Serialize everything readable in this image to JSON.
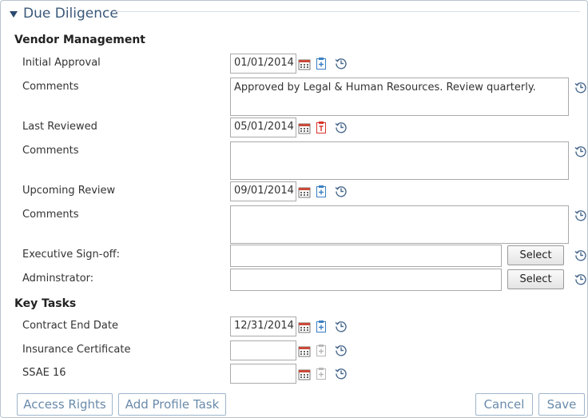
{
  "panel": {
    "title": "Due Diligence"
  },
  "vendor_management": {
    "heading": "Vendor Management",
    "initial_approval": {
      "label": "Initial Approval",
      "value": "01/01/2014"
    },
    "comments_1": {
      "label": "Comments",
      "value": "Approved by Legal & Human Resources. Review quarterly."
    },
    "last_reviewed": {
      "label": "Last Reviewed",
      "value": "05/01/2014"
    },
    "comments_2": {
      "label": "Comments",
      "value": ""
    },
    "upcoming_review": {
      "label": "Upcoming Review",
      "value": "09/01/2014"
    },
    "comments_3": {
      "label": "Comments",
      "value": ""
    },
    "executive_signoff": {
      "label": "Executive Sign-off:",
      "value": "",
      "button": "Select"
    },
    "administrator": {
      "label": "Adminstrator:",
      "value": "",
      "button": "Select"
    }
  },
  "key_tasks": {
    "heading": "Key Tasks",
    "contract_end_date": {
      "label": "Contract End Date",
      "value": "12/31/2014"
    },
    "insurance_certificate": {
      "label": "Insurance Certificate",
      "value": ""
    },
    "ssae16": {
      "label": "SSAE 16",
      "value": ""
    }
  },
  "footer": {
    "access_rights": "Access Rights",
    "add_profile_task": "Add Profile Task",
    "cancel": "Cancel",
    "save": "Save"
  },
  "icons": {
    "calendar": "calendar-icon",
    "task_add": "task-add-icon",
    "task_alert": "task-alert-icon",
    "history": "history-icon"
  },
  "colors": {
    "accent": "#3b7fc4",
    "alert": "#d9342b",
    "disabled": "#b8b8b8",
    "history": "#4a6a8f"
  }
}
